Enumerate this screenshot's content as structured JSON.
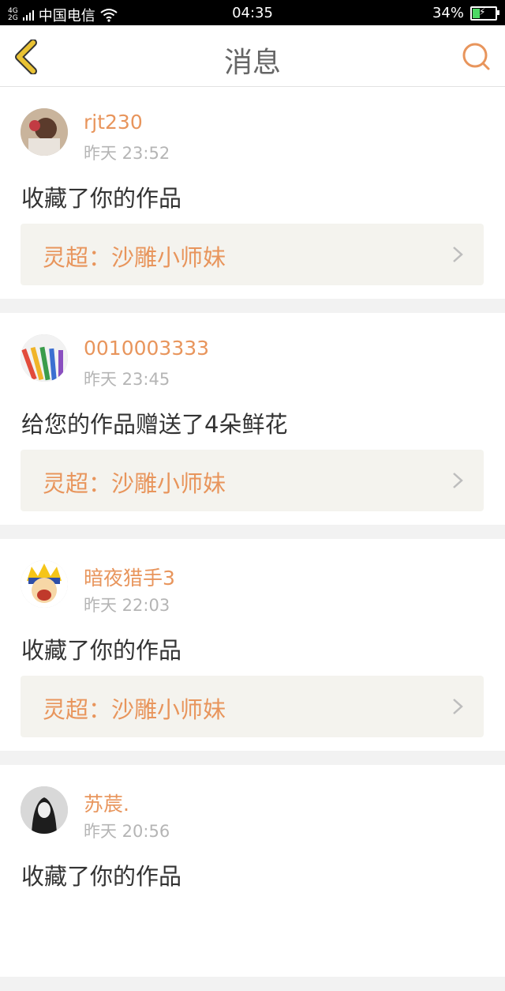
{
  "status_bar": {
    "network": [
      "4G",
      "2G"
    ],
    "carrier": "中国电信",
    "time": "04:35",
    "battery_percent": "34%"
  },
  "header": {
    "title": "消息",
    "back_icon": "back-chevron-icon",
    "search_icon": "search-icon"
  },
  "colors": {
    "accent": "#e8955c",
    "back_chevron": "#e9c233",
    "background": "#f2f2f2",
    "card_bg": "#ffffff",
    "work_bg": "#f4f3ee"
  },
  "messages": [
    {
      "user": "rjt230",
      "time": "昨天 23:52",
      "action": "收藏了你的作品",
      "work": "灵超：沙雕小师妹"
    },
    {
      "user": "0010003333",
      "time": "昨天 23:45",
      "action": "给您的作品赠送了4朵鲜花",
      "work": "灵超：沙雕小师妹"
    },
    {
      "user": "暗夜猎手3",
      "time": "昨天 22:03",
      "action": "收藏了你的作品",
      "work": "灵超：沙雕小师妹"
    },
    {
      "user": "苏莀.",
      "time": "昨天 20:56",
      "action": "收藏了你的作品",
      "work": ""
    }
  ]
}
